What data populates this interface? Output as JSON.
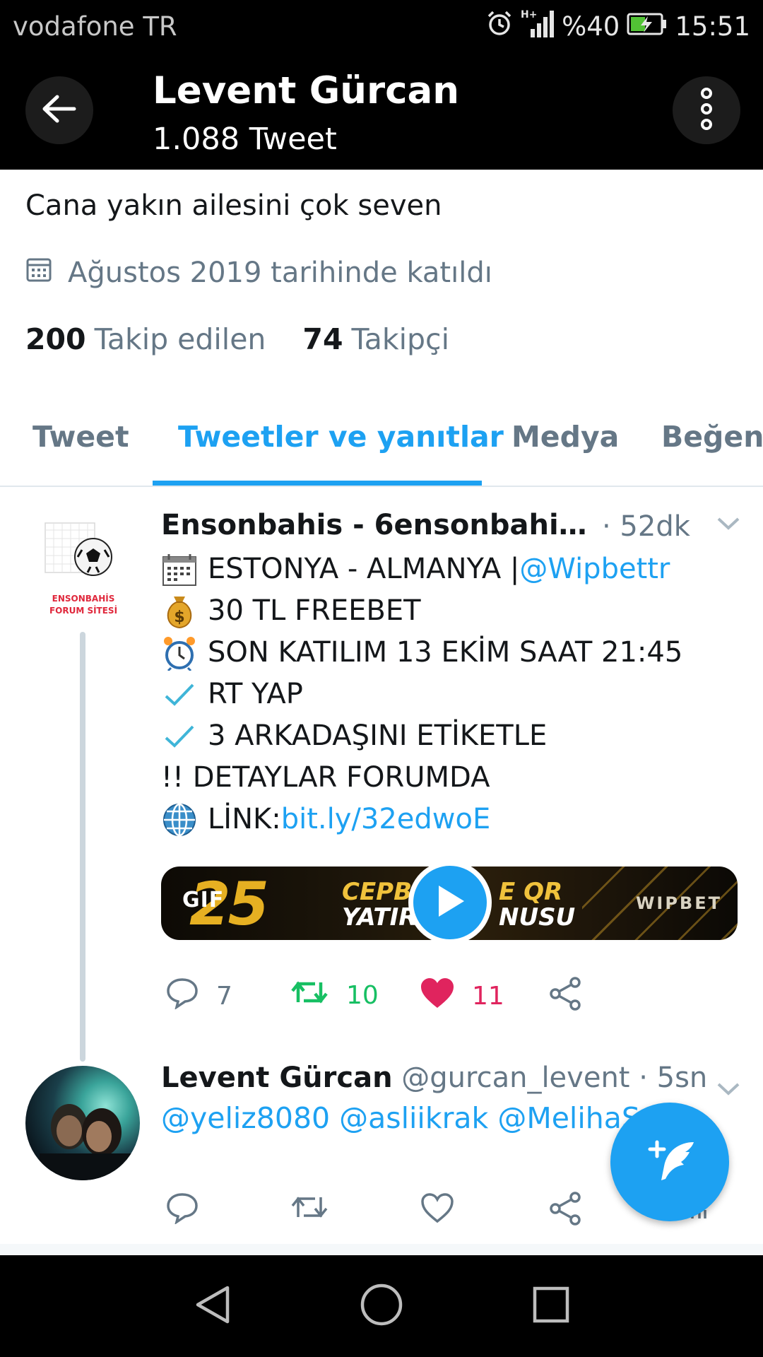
{
  "status_bar": {
    "carrier": "vodafone TR",
    "network": "H+",
    "battery_percent": "%40",
    "time": "15:51"
  },
  "header": {
    "name": "Levent Gürcan",
    "tweet_count": "1.088 Tweet"
  },
  "profile": {
    "bio": "Cana yakın ailesini çok seven",
    "joined": "Ağustos 2019 tarihinde katıldı",
    "following_count": "200",
    "following_label": "Takip edilen",
    "followers_count": "74",
    "followers_label": "Takipçi"
  },
  "tabs": [
    {
      "label": "Tweet",
      "active": false
    },
    {
      "label": "Tweetler ve yanıtlar",
      "active": true
    },
    {
      "label": "Medya",
      "active": false
    },
    {
      "label": "Beğenil",
      "active": false
    }
  ],
  "tweets": [
    {
      "author": "Ensonbahis - 6ensonbahis.c...",
      "time": "· 52dk",
      "avatar_text": "ENSONBAHİS FORUM SİTESİ",
      "lines": [
        {
          "icon": "calendar-emoji",
          "text": "ESTONYA - ALMANYA | ",
          "link": "@Wipbettr"
        },
        {
          "icon": "money-bag-emoji",
          "text": "30 TL FREEBET"
        },
        {
          "icon": "alarm-clock-emoji",
          "text": "SON KATILIM 13 EKİM SAAT 21:45"
        },
        {
          "icon": "check-mark-emoji",
          "text": "RT YAP"
        },
        {
          "icon": "check-mark-emoji",
          "text": "3 ARKADAŞINI ETİKETLE"
        },
        {
          "icon": "",
          "text": "!! DETAYLAR FORUMDA"
        },
        {
          "icon": "globe-emoji",
          "text": "LİNK: ",
          "link": "bit.ly/32edwoE"
        }
      ],
      "media": {
        "badge": "GIF",
        "big_number": "25",
        "text_top_left": "CEPB",
        "text_bottom_left": "YATIR",
        "text_top_right": "E QR",
        "text_bottom_right": "NUSU",
        "brand": "WIPBET"
      },
      "replies": "7",
      "retweets": "10",
      "likes": "11"
    },
    {
      "author": "Levent Gürcan",
      "handle": "@gurcan_levent · 5sn",
      "body": "@yeliz8080 @asliikrak @MelihaSa..."
    }
  ],
  "colors": {
    "accent": "#1da1f2",
    "retweet": "#17bf63",
    "like": "#e0245e",
    "secondary_text": "#657786"
  }
}
